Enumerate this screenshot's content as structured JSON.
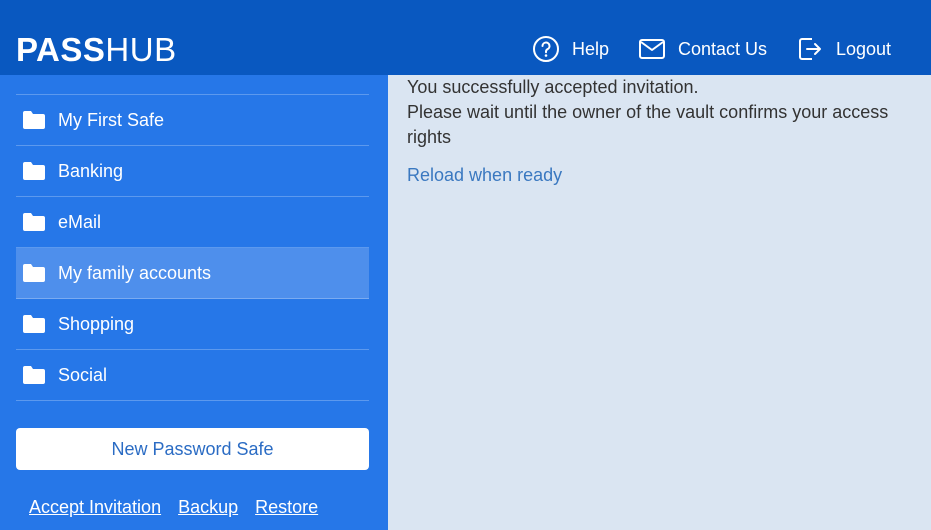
{
  "header": {
    "logo_bold": "PASS",
    "logo_light": "HUB",
    "nav": {
      "help": "Help",
      "contact": "Contact Us",
      "logout": "Logout"
    }
  },
  "sidebar": {
    "safes": [
      {
        "label": "My First Safe"
      },
      {
        "label": "Banking"
      },
      {
        "label": "eMail"
      },
      {
        "label": "My family accounts",
        "active": true
      },
      {
        "label": "Shopping"
      },
      {
        "label": "Social"
      }
    ],
    "new_safe_label": "New Password Safe",
    "links": {
      "accept": "Accept Invitation",
      "backup": "Backup",
      "restore": "Restore"
    }
  },
  "main": {
    "line1": "You successfully accepted invitation.",
    "line2": "Please wait until the owner of the vault confirms your access rights",
    "reload": "Reload when ready"
  },
  "colors": {
    "header": "#0958c0",
    "sidebar": "#2677e8",
    "active_item": "#4e8fec",
    "content_bg": "#dae5f2",
    "link": "#3a78c0"
  }
}
